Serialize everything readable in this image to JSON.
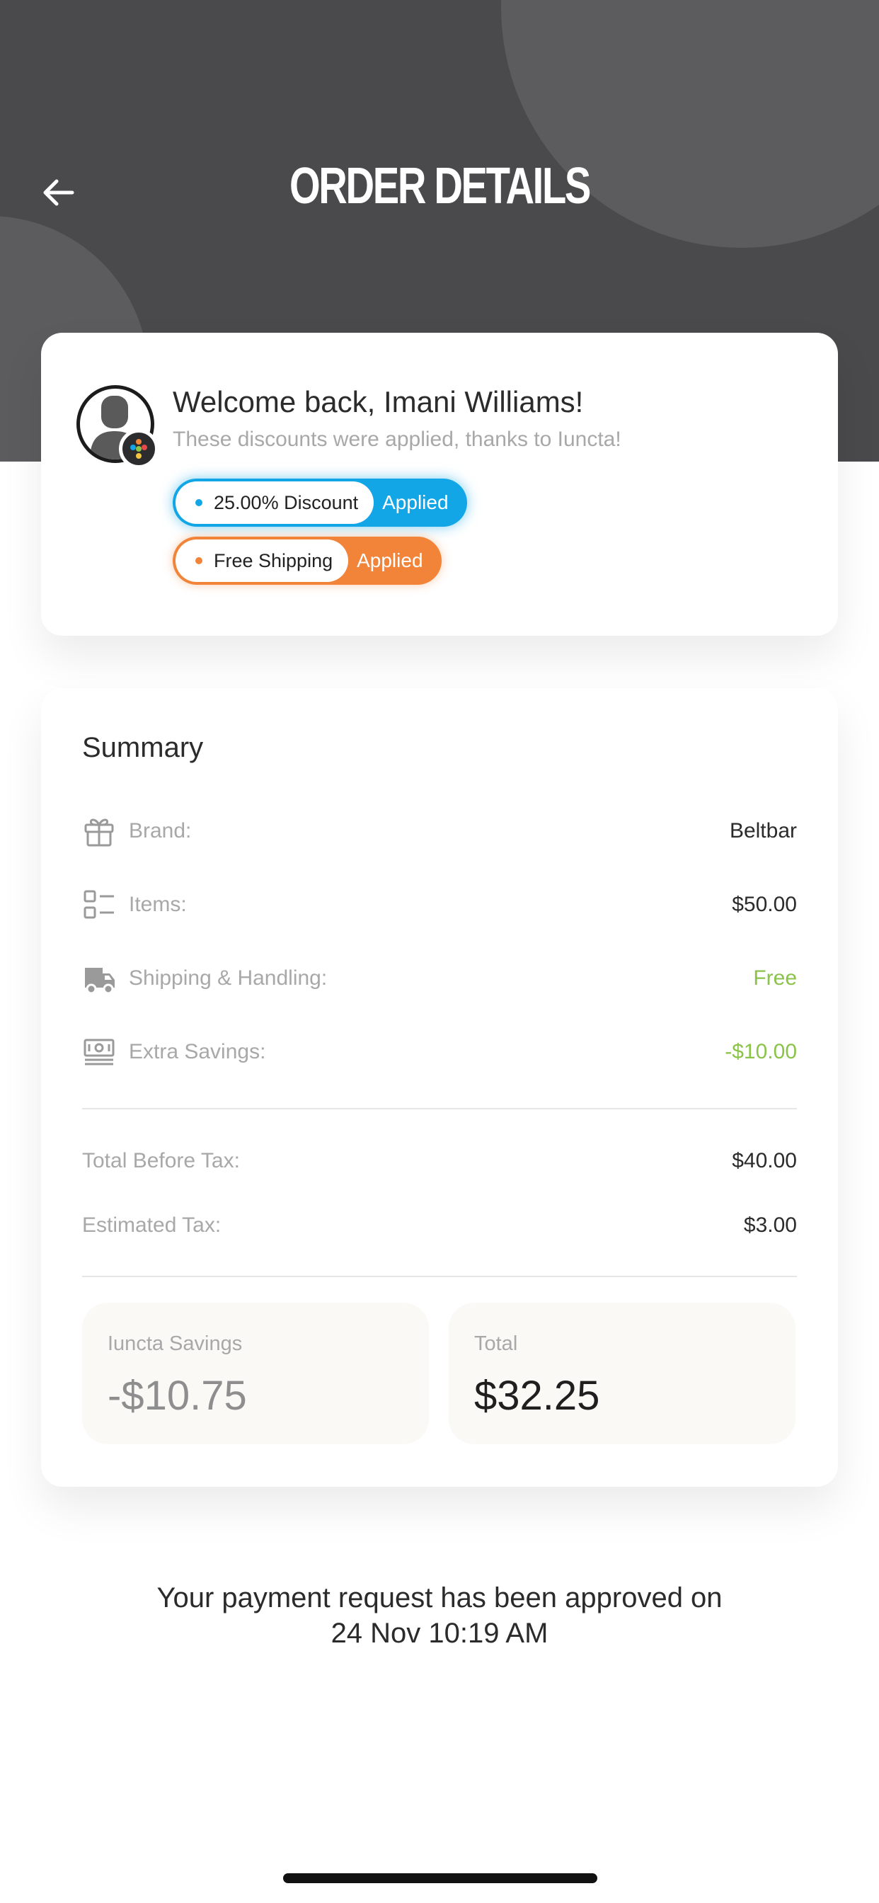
{
  "header": {
    "title": "ORDER DETAILS",
    "back_icon": "arrow-left-icon"
  },
  "welcome": {
    "title": "Welcome back, Imani Williams!",
    "subtitle": "These discounts were applied, thanks to Iuncta!",
    "discounts": [
      {
        "label": "25.00% Discount",
        "status": "Applied",
        "color": "#12a6e6"
      },
      {
        "label": "Free Shipping",
        "status": "Applied",
        "color": "#f2843a"
      }
    ]
  },
  "summary": {
    "title": "Summary",
    "rows": [
      {
        "icon": "gift-icon",
        "label": "Brand:",
        "value": "Beltbar"
      },
      {
        "icon": "list-icon",
        "label": "Items:",
        "value": "$50.00"
      },
      {
        "icon": "truck-icon",
        "label": "Shipping & Handling:",
        "value": "Free"
      },
      {
        "icon": "cash-icon",
        "label": "Extra Savings:",
        "value": "-$10.00"
      }
    ],
    "totals": [
      {
        "label": "Total Before Tax:",
        "value": "$40.00"
      },
      {
        "label": "Estimated Tax:",
        "value": "$3.00"
      }
    ],
    "savings": {
      "label": "Iuncta Savings",
      "value": "-$10.75"
    },
    "total": {
      "label": "Total",
      "value": "$32.25"
    }
  },
  "footer": {
    "line1": "Your payment request has been approved on",
    "line2": "24 Nov 10:19 AM"
  },
  "colors": {
    "header_bg": "#4a4a4c",
    "discount_blue": "#12a6e6",
    "shipping_orange": "#f2843a",
    "positive_green": "#8bc34a"
  }
}
